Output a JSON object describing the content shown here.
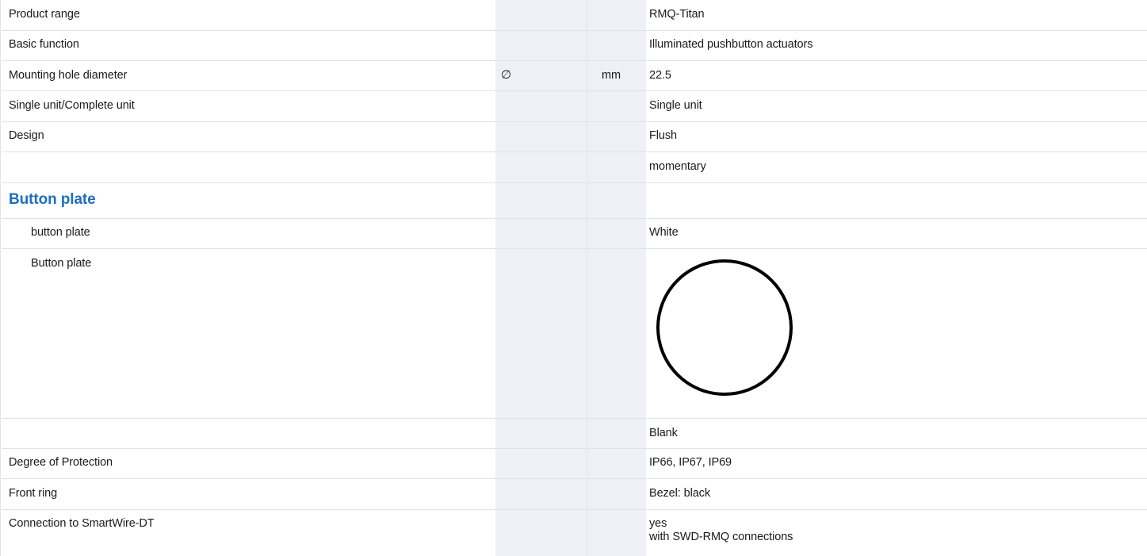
{
  "rows": {
    "r0": {
      "label": "Product range",
      "value": "RMQ-Titan"
    },
    "r1": {
      "label": "Basic function",
      "value": "Illuminated pushbutton actuators"
    },
    "r2": {
      "label": "Mounting hole diameter",
      "symbol": "∅",
      "unit": "mm",
      "value": "22.5"
    },
    "r3": {
      "label": "Single unit/Complete unit",
      "value": "Single unit"
    },
    "r4": {
      "label": "Design",
      "value": "Flush"
    },
    "r5": {
      "label": "",
      "value": "momentary"
    },
    "section": {
      "title": "Button plate"
    },
    "r6": {
      "label": "button plate",
      "value": "White"
    },
    "r7": {
      "label": "Button plate",
      "image": "white-circle-button-plate"
    },
    "r8": {
      "label": "",
      "value": "Blank"
    },
    "r9": {
      "label": "Degree of Protection",
      "value": "IP66, IP67, IP69"
    },
    "r10": {
      "label": "Front ring",
      "value": "Bezel: black"
    },
    "r11": {
      "label": "Connection to SmartWire-DT",
      "value_line1": "yes",
      "value_line2": "with SWD-RMQ connections"
    }
  },
  "colors": {
    "section_title": "#1d6fbf",
    "unit_band": "#eef0f5",
    "row_divider": "#e2e2e2",
    "swatch_stroke": "#000000",
    "swatch_fill": "#ffffff"
  }
}
